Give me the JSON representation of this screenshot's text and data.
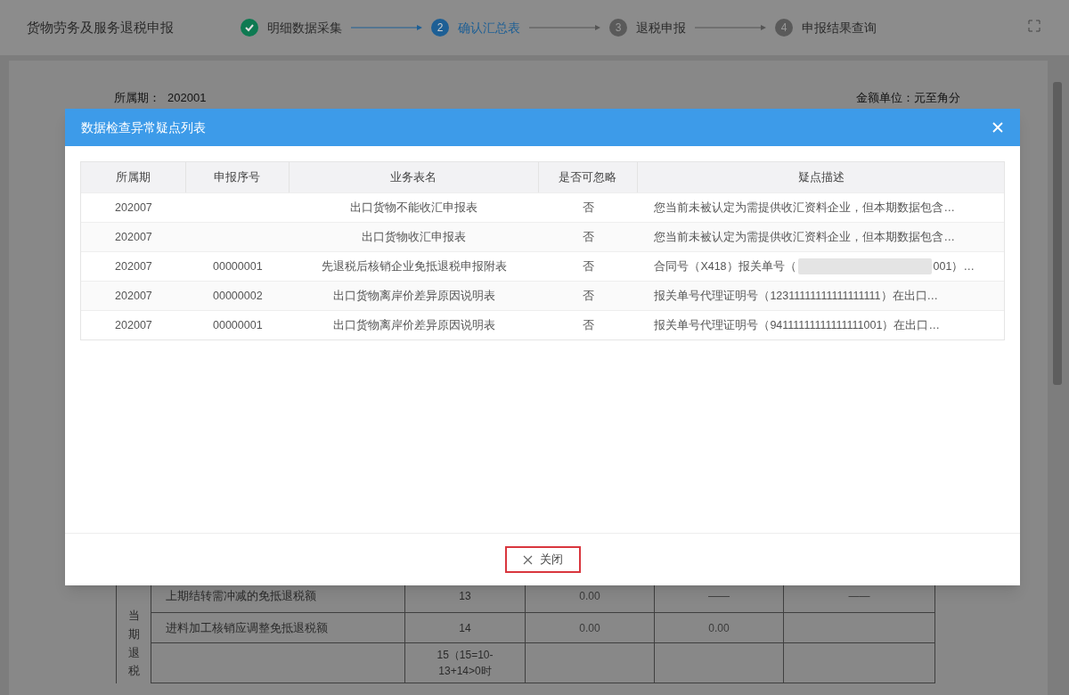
{
  "header": {
    "title": "货物劳务及服务退税申报",
    "steps": [
      {
        "label": "明细数据采集",
        "done": true,
        "selected": false
      },
      {
        "label": "确认汇总表",
        "done": false,
        "selected": true,
        "number": "2"
      },
      {
        "label": "退税申报",
        "done": false,
        "selected": false,
        "number": "3"
      },
      {
        "label": "申报结果查询",
        "done": false,
        "selected": false,
        "number": "4"
      }
    ]
  },
  "page": {
    "period_label": "所属期：",
    "period": "202001",
    "unit": "金额单位：元至角分",
    "table": {
      "side_label": "当期退税",
      "rows": [
        {
          "item": "上期结转需冲减的免抵退税额",
          "line": "13",
          "values": [
            "0.00",
            "——",
            "——"
          ]
        },
        {
          "item": "进料加工核销应调整免抵退税额",
          "line": "14",
          "values": [
            "0.00",
            "0.00"
          ]
        },
        {
          "item": "",
          "line": "15（15=10-13+14>0时",
          "values": []
        }
      ]
    }
  },
  "dialog": {
    "title": "数据检查异常疑点列表",
    "columns": [
      "所属期",
      "申报序号",
      "业务表名",
      "是否可忽略",
      "疑点描述"
    ],
    "rows": [
      {
        "period": "202007",
        "serial": "",
        "form": "出口货物不能收汇申报表",
        "ignorable": "否",
        "description": "您当前未被认定为需提供收汇资料企业，但本期数据包含…"
      },
      {
        "period": "202007",
        "serial": "",
        "form": "出口货物收汇申报表",
        "ignorable": "否",
        "description": "您当前未被认定为需提供收汇资料企业，但本期数据包含…"
      },
      {
        "period": "202007",
        "serial": "00000001",
        "form": "先退税后核销企业免抵退税申报附表",
        "ignorable": "否",
        "description": "合同号（X418）报关单号（",
        "redacted": true,
        "description_end": "001）…"
      },
      {
        "period": "202007",
        "serial": "00000002",
        "form": "出口货物离岸价差异原因说明表",
        "ignorable": "否",
        "description": "报关单号代理证明号（12311111111111111111）在出口…"
      },
      {
        "period": "202007",
        "serial": "00000001",
        "form": "出口货物离岸价差异原因说明表",
        "ignorable": "否",
        "description": "报关单号代理证明号（94111111111111111001）在出口…"
      }
    ],
    "close_button": {
      "label": "关闭",
      "highlighted": true
    }
  }
}
